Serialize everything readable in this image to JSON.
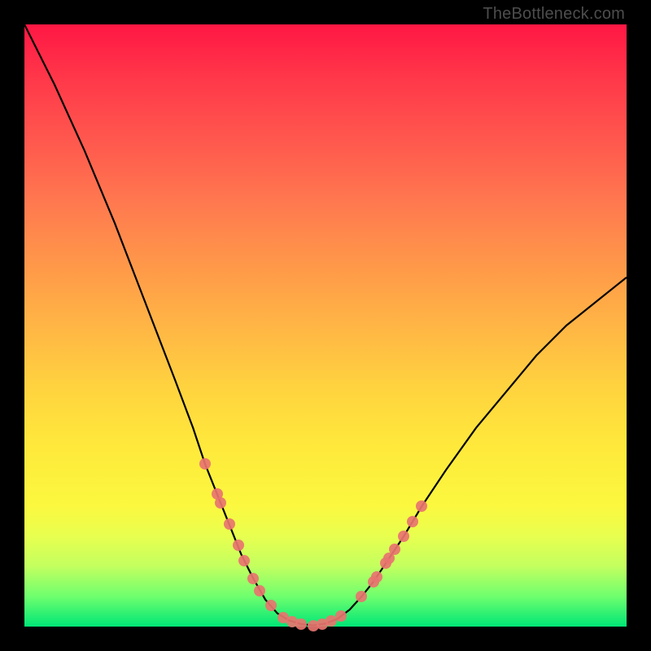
{
  "watermark": "TheBottleneck.com",
  "chart_data": {
    "type": "line",
    "title": "",
    "xlabel": "",
    "ylabel": "",
    "xlim": [
      0,
      100
    ],
    "ylim": [
      0,
      100
    ],
    "curve": [
      {
        "x": 0,
        "y": 100
      },
      {
        "x": 5,
        "y": 90
      },
      {
        "x": 10,
        "y": 79
      },
      {
        "x": 15,
        "y": 67
      },
      {
        "x": 20,
        "y": 54
      },
      {
        "x": 25,
        "y": 41
      },
      {
        "x": 28,
        "y": 33
      },
      {
        "x": 30,
        "y": 27
      },
      {
        "x": 32,
        "y": 22
      },
      {
        "x": 34,
        "y": 17
      },
      {
        "x": 36,
        "y": 12
      },
      {
        "x": 38,
        "y": 8
      },
      {
        "x": 40,
        "y": 4.5
      },
      {
        "x": 42,
        "y": 2.2
      },
      {
        "x": 44,
        "y": 1
      },
      {
        "x": 46,
        "y": 0.4
      },
      {
        "x": 48,
        "y": 0.2
      },
      {
        "x": 50,
        "y": 0.5
      },
      {
        "x": 52,
        "y": 1.3
      },
      {
        "x": 54,
        "y": 2.8
      },
      {
        "x": 56,
        "y": 5
      },
      {
        "x": 58,
        "y": 7.5
      },
      {
        "x": 60,
        "y": 10.5
      },
      {
        "x": 63,
        "y": 15
      },
      {
        "x": 66,
        "y": 20
      },
      {
        "x": 70,
        "y": 26
      },
      {
        "x": 75,
        "y": 33
      },
      {
        "x": 80,
        "y": 39
      },
      {
        "x": 85,
        "y": 45
      },
      {
        "x": 90,
        "y": 50
      },
      {
        "x": 95,
        "y": 54
      },
      {
        "x": 100,
        "y": 58
      }
    ],
    "highlight_points": [
      {
        "x": 30,
        "y": 27
      },
      {
        "x": 32,
        "y": 22
      },
      {
        "x": 32.5,
        "y": 20.5
      },
      {
        "x": 34,
        "y": 17
      },
      {
        "x": 35.5,
        "y": 13.5
      },
      {
        "x": 36.5,
        "y": 11
      },
      {
        "x": 38,
        "y": 8
      },
      {
        "x": 39,
        "y": 6
      },
      {
        "x": 41,
        "y": 3.5
      },
      {
        "x": 43,
        "y": 1.5
      },
      {
        "x": 44.5,
        "y": 0.8
      },
      {
        "x": 46,
        "y": 0.4
      },
      {
        "x": 48,
        "y": 0.2
      },
      {
        "x": 49.5,
        "y": 0.4
      },
      {
        "x": 51,
        "y": 0.9
      },
      {
        "x": 52.5,
        "y": 1.7
      },
      {
        "x": 56,
        "y": 5
      },
      {
        "x": 58,
        "y": 7.5
      },
      {
        "x": 58.5,
        "y": 8.2
      },
      {
        "x": 60,
        "y": 10.5
      },
      {
        "x": 60.5,
        "y": 11.3
      },
      {
        "x": 61.5,
        "y": 12.8
      },
      {
        "x": 63,
        "y": 15
      },
      {
        "x": 64.5,
        "y": 17.5
      },
      {
        "x": 66,
        "y": 20
      }
    ]
  },
  "colors": {
    "dot": "#e8746f",
    "curve": "#000000"
  }
}
